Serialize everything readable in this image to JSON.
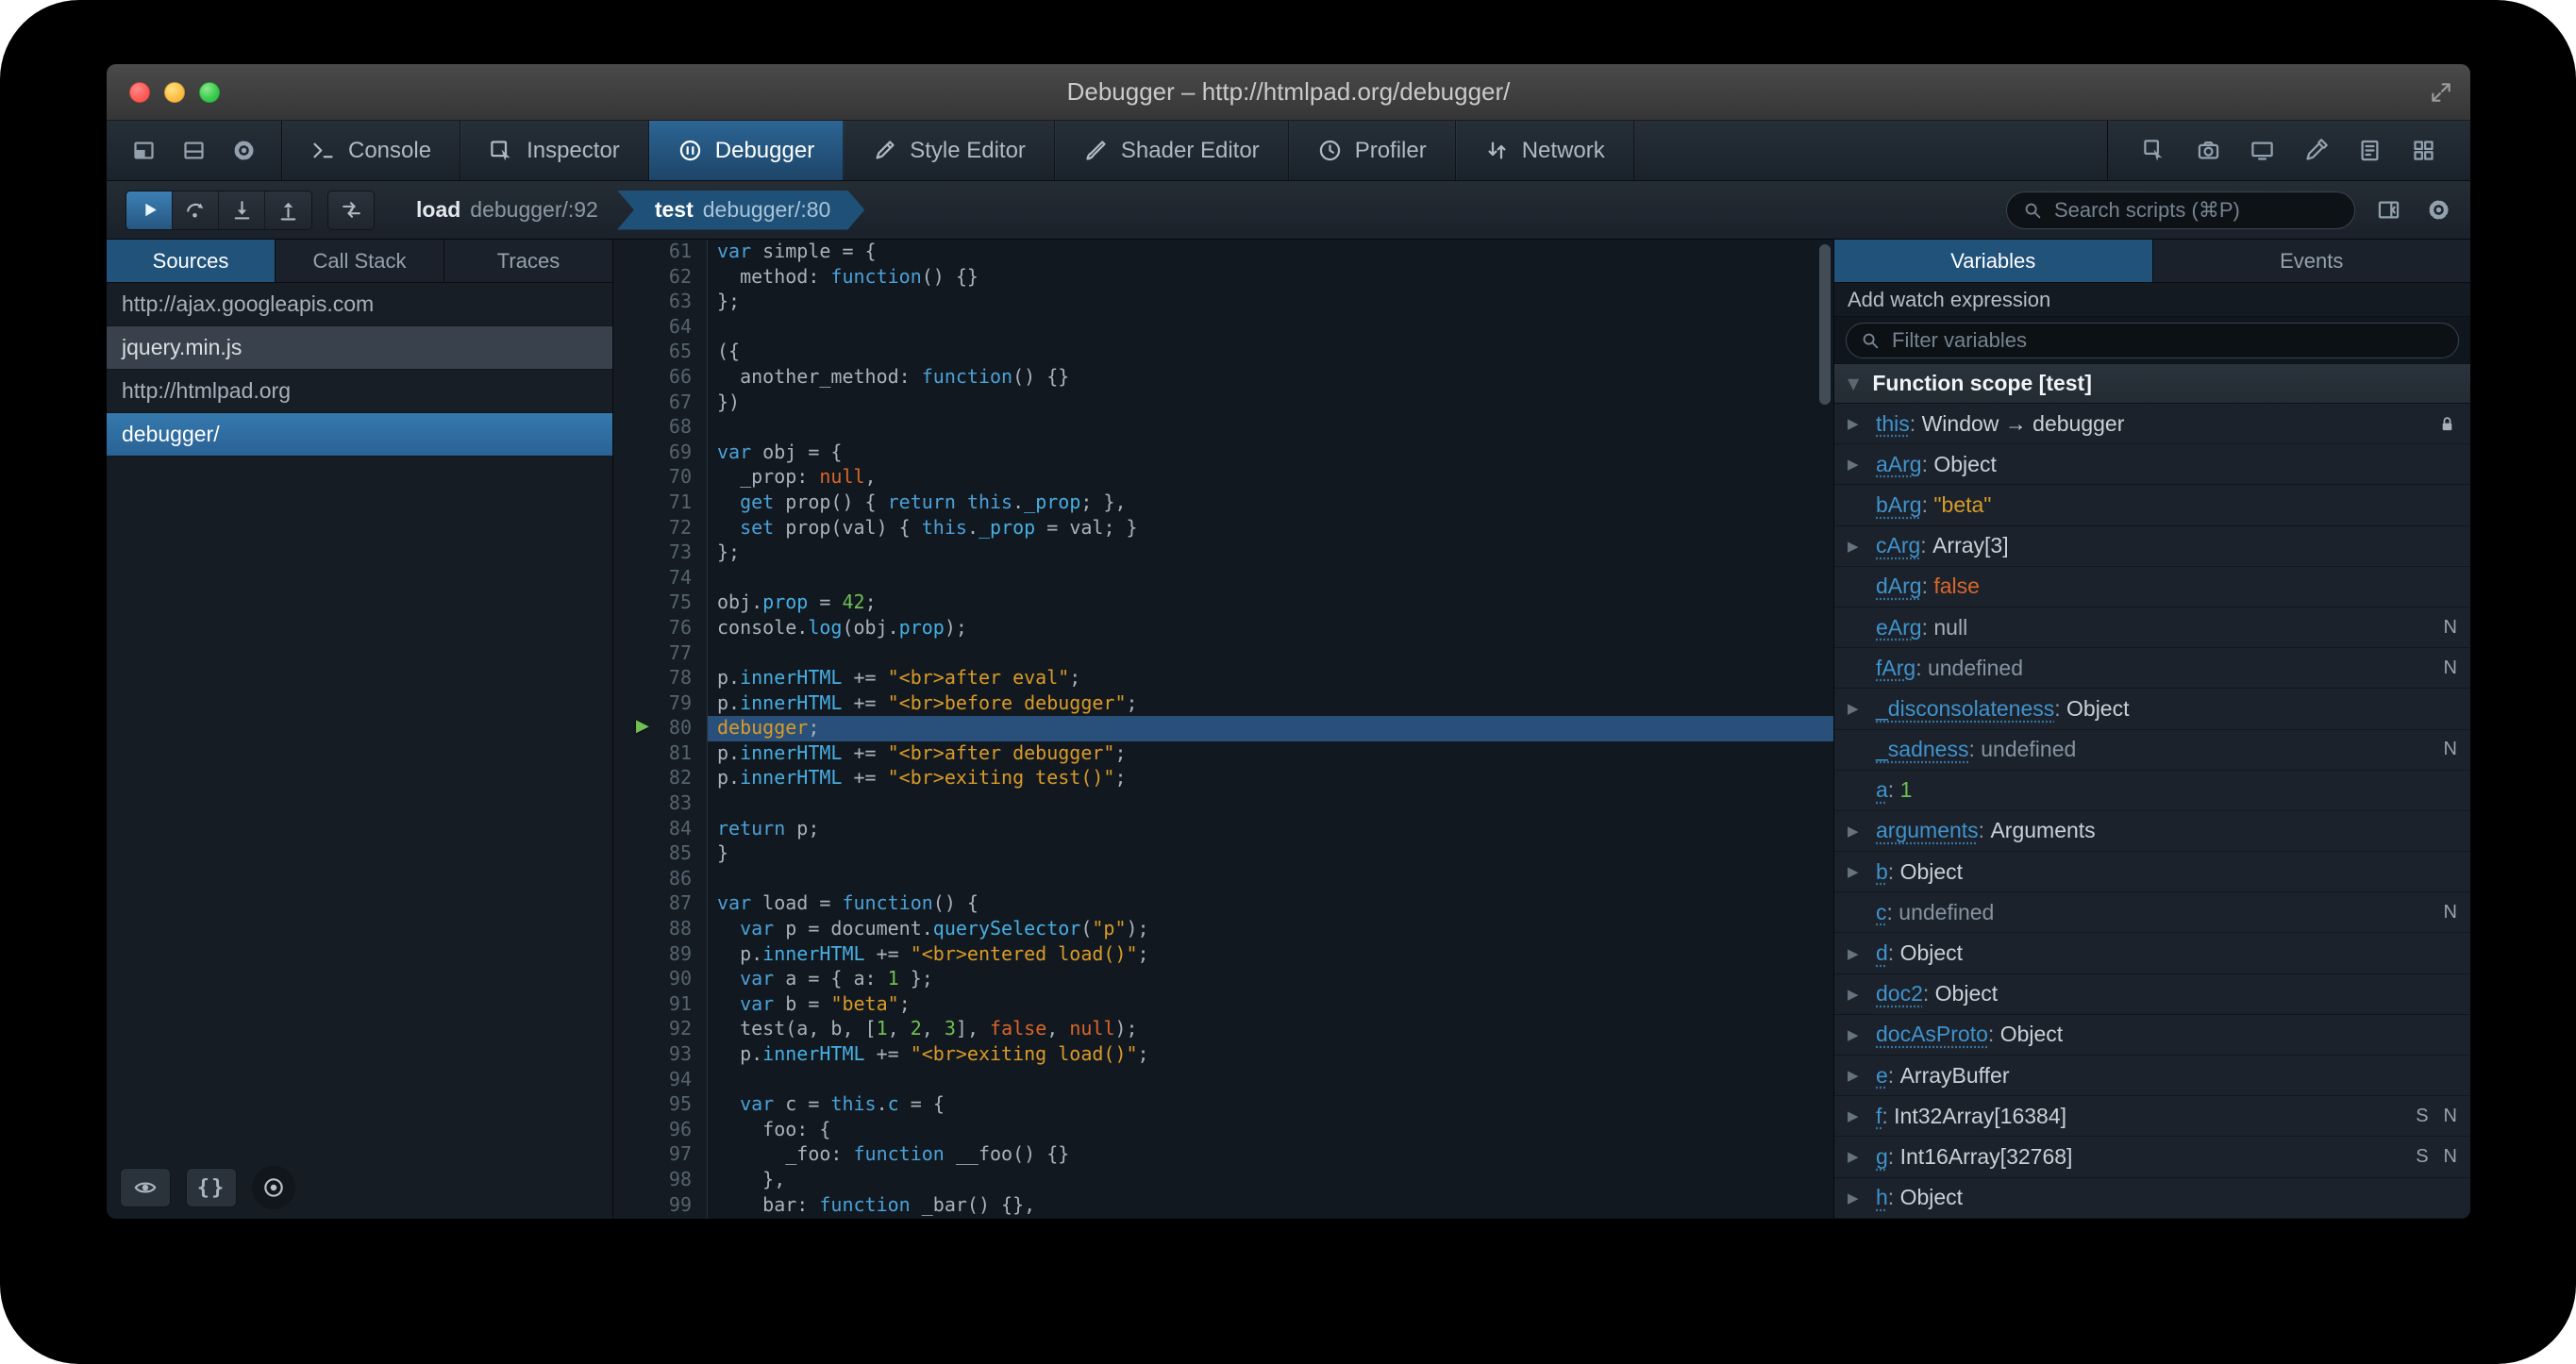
{
  "titlebar": {
    "title": "Debugger – http://htmlpad.org/debugger/",
    "fullscreen_icon": "fullscreen-icon"
  },
  "colors": {
    "accent_blue": "#1d4f73",
    "selection_blue": "#29507a",
    "string_orange": "#d99b28",
    "number_green": "#6fbf53",
    "atom_orange": "#d96629",
    "keyword_blue": "#4aa1d8",
    "property_cyan": "#46afe3",
    "paused_arrow_green": "#72c054"
  },
  "toolbox": {
    "left_icons": [
      "undock-icon",
      "split-console-icon",
      "options-gear-icon"
    ],
    "tabs": [
      {
        "label": "Console",
        "icon": "console-icon"
      },
      {
        "label": "Inspector",
        "icon": "inspector-icon"
      },
      {
        "label": "Debugger",
        "icon": "debugger-icon"
      },
      {
        "label": "Style Editor",
        "icon": "style-editor-icon"
      },
      {
        "label": "Shader Editor",
        "icon": "shader-editor-icon"
      },
      {
        "label": "Profiler",
        "icon": "profiler-icon"
      },
      {
        "label": "Network",
        "icon": "network-icon"
      }
    ],
    "active_tab": "Debugger",
    "right_icons": [
      "pick-element-icon",
      "camera-icon",
      "responsive-mode-icon",
      "eyedropper-icon",
      "scratchpad-icon",
      "grid-icon"
    ]
  },
  "debug_toolbar": {
    "buttons": [
      {
        "name": "resume-button",
        "icon": "resume-icon",
        "pressed": true
      },
      {
        "name": "step-over-button",
        "icon": "step-over-icon"
      },
      {
        "name": "step-in-button",
        "icon": "step-in-icon"
      },
      {
        "name": "step-out-button",
        "icon": "step-out-icon"
      }
    ],
    "trace_icon": "trace-icon",
    "breadcrumbs": [
      {
        "func": "load",
        "location": "debugger/:92",
        "active": false
      },
      {
        "func": "test",
        "location": "debugger/:80",
        "active": true
      }
    ],
    "search_placeholder": "Search scripts (⌘P)",
    "search_icon": "search-icon",
    "right_icons": [
      "toggle-panes-icon",
      "debugger-options-gear-icon"
    ]
  },
  "sources_panel": {
    "tabs": [
      "Sources",
      "Call Stack",
      "Traces"
    ],
    "active_tab": "Sources",
    "items": [
      {
        "label": "http://ajax.googleapis.com",
        "kind": "group",
        "selected": false
      },
      {
        "label": "jquery.min.js",
        "kind": "item",
        "selected": false
      },
      {
        "label": "http://htmlpad.org",
        "kind": "group",
        "selected": false
      },
      {
        "label": "debugger/",
        "kind": "item",
        "selected": true
      }
    ],
    "buttons": [
      {
        "name": "blackbox-button",
        "icon": "eye-icon"
      },
      {
        "name": "pretty-print-button",
        "icon": "braces-icon"
      },
      {
        "name": "pause-exceptions-button",
        "icon": "pause-circle-icon",
        "round": true
      }
    ]
  },
  "editor": {
    "current_line": 80,
    "lines": [
      {
        "n": 61,
        "s": [
          [
            "k",
            "var"
          ],
          [
            "d",
            " simple = {"
          ]
        ]
      },
      {
        "n": 62,
        "s": [
          [
            "d",
            "  method: "
          ],
          [
            "k",
            "function"
          ],
          [
            "d",
            "() {}"
          ]
        ]
      },
      {
        "n": 63,
        "s": [
          [
            "d",
            "};"
          ]
        ]
      },
      {
        "n": 64,
        "s": []
      },
      {
        "n": 65,
        "s": [
          [
            "d",
            "({"
          ]
        ]
      },
      {
        "n": 66,
        "s": [
          [
            "d",
            "  another_method: "
          ],
          [
            "k",
            "function"
          ],
          [
            "d",
            "() {}"
          ]
        ]
      },
      {
        "n": 67,
        "s": [
          [
            "d",
            "})"
          ]
        ]
      },
      {
        "n": 68,
        "s": []
      },
      {
        "n": 69,
        "s": [
          [
            "k",
            "var"
          ],
          [
            "d",
            " obj = {"
          ]
        ]
      },
      {
        "n": 70,
        "s": [
          [
            "d",
            "  _prop: "
          ],
          [
            "a",
            "null"
          ],
          [
            "d",
            ","
          ]
        ]
      },
      {
        "n": 71,
        "s": [
          [
            "d",
            "  "
          ],
          [
            "k",
            "get"
          ],
          [
            "d",
            " prop() { "
          ],
          [
            "k",
            "return"
          ],
          [
            "d",
            " "
          ],
          [
            "k",
            "this"
          ],
          [
            "d",
            "."
          ],
          [
            "p",
            "_prop"
          ],
          [
            "d",
            "; },"
          ]
        ]
      },
      {
        "n": 72,
        "s": [
          [
            "d",
            "  "
          ],
          [
            "k",
            "set"
          ],
          [
            "d",
            " prop(val) { "
          ],
          [
            "k",
            "this"
          ],
          [
            "d",
            "."
          ],
          [
            "p",
            "_prop"
          ],
          [
            "d",
            " = val; }"
          ]
        ]
      },
      {
        "n": 73,
        "s": [
          [
            "d",
            "};"
          ]
        ]
      },
      {
        "n": 74,
        "s": []
      },
      {
        "n": 75,
        "s": [
          [
            "d",
            "obj."
          ],
          [
            "p",
            "prop"
          ],
          [
            "d",
            " = "
          ],
          [
            "n",
            "42"
          ],
          [
            "d",
            ";"
          ]
        ]
      },
      {
        "n": 76,
        "s": [
          [
            "d",
            "console."
          ],
          [
            "p",
            "log"
          ],
          [
            "d",
            "(obj."
          ],
          [
            "p",
            "prop"
          ],
          [
            "d",
            ");"
          ]
        ]
      },
      {
        "n": 77,
        "s": []
      },
      {
        "n": 78,
        "s": [
          [
            "d",
            "p."
          ],
          [
            "p",
            "innerHTML"
          ],
          [
            "d",
            " += "
          ],
          [
            "s",
            "\"<br>after eval\""
          ],
          [
            "d",
            ";"
          ]
        ]
      },
      {
        "n": 79,
        "s": [
          [
            "d",
            "p."
          ],
          [
            "p",
            "innerHTML"
          ],
          [
            "d",
            " += "
          ],
          [
            "s",
            "\"<br>before debugger\""
          ],
          [
            "d",
            ";"
          ]
        ]
      },
      {
        "n": 80,
        "s": [
          [
            "s",
            "debugger"
          ],
          [
            "d",
            ";"
          ]
        ]
      },
      {
        "n": 81,
        "s": [
          [
            "d",
            "p."
          ],
          [
            "p",
            "innerHTML"
          ],
          [
            "d",
            " += "
          ],
          [
            "s",
            "\"<br>after debugger\""
          ],
          [
            "d",
            ";"
          ]
        ]
      },
      {
        "n": 82,
        "s": [
          [
            "d",
            "p."
          ],
          [
            "p",
            "innerHTML"
          ],
          [
            "d",
            " += "
          ],
          [
            "s",
            "\"<br>exiting test()\""
          ],
          [
            "d",
            ";"
          ]
        ]
      },
      {
        "n": 83,
        "s": []
      },
      {
        "n": 84,
        "s": [
          [
            "k",
            "return"
          ],
          [
            "d",
            " p;"
          ]
        ]
      },
      {
        "n": 85,
        "s": [
          [
            "d",
            "}"
          ]
        ]
      },
      {
        "n": 86,
        "s": []
      },
      {
        "n": 87,
        "s": [
          [
            "k",
            "var"
          ],
          [
            "d",
            " load = "
          ],
          [
            "k",
            "function"
          ],
          [
            "d",
            "() {"
          ]
        ]
      },
      {
        "n": 88,
        "s": [
          [
            "d",
            "  "
          ],
          [
            "k",
            "var"
          ],
          [
            "d",
            " p = document."
          ],
          [
            "p",
            "querySelector"
          ],
          [
            "d",
            "("
          ],
          [
            "s",
            "\"p\""
          ],
          [
            "d",
            ");"
          ]
        ]
      },
      {
        "n": 89,
        "s": [
          [
            "d",
            "  p."
          ],
          [
            "p",
            "innerHTML"
          ],
          [
            "d",
            " += "
          ],
          [
            "s",
            "\"<br>entered load()\""
          ],
          [
            "d",
            ";"
          ]
        ]
      },
      {
        "n": 90,
        "s": [
          [
            "d",
            "  "
          ],
          [
            "k",
            "var"
          ],
          [
            "d",
            " a = { a: "
          ],
          [
            "n",
            "1"
          ],
          [
            "d",
            " };"
          ]
        ]
      },
      {
        "n": 91,
        "s": [
          [
            "d",
            "  "
          ],
          [
            "k",
            "var"
          ],
          [
            "d",
            " b = "
          ],
          [
            "s",
            "\"beta\""
          ],
          [
            "d",
            ";"
          ]
        ]
      },
      {
        "n": 92,
        "s": [
          [
            "d",
            "  test(a, b, ["
          ],
          [
            "n",
            "1"
          ],
          [
            "d",
            ", "
          ],
          [
            "n",
            "2"
          ],
          [
            "d",
            ", "
          ],
          [
            "n",
            "3"
          ],
          [
            "d",
            "], "
          ],
          [
            "a",
            "false"
          ],
          [
            "d",
            ", "
          ],
          [
            "a",
            "null"
          ],
          [
            "d",
            ");"
          ]
        ]
      },
      {
        "n": 93,
        "s": [
          [
            "d",
            "  p."
          ],
          [
            "p",
            "innerHTML"
          ],
          [
            "d",
            " += "
          ],
          [
            "s",
            "\"<br>exiting load()\""
          ],
          [
            "d",
            ";"
          ]
        ]
      },
      {
        "n": 94,
        "s": []
      },
      {
        "n": 95,
        "s": [
          [
            "d",
            "  "
          ],
          [
            "k",
            "var"
          ],
          [
            "d",
            " c = "
          ],
          [
            "k",
            "this"
          ],
          [
            "d",
            "."
          ],
          [
            "p",
            "c"
          ],
          [
            "d",
            " = {"
          ]
        ]
      },
      {
        "n": 96,
        "s": [
          [
            "d",
            "    foo: {"
          ]
        ]
      },
      {
        "n": 97,
        "s": [
          [
            "d",
            "      _foo: "
          ],
          [
            "k",
            "function"
          ],
          [
            "d",
            " __foo() {}"
          ]
        ]
      },
      {
        "n": 98,
        "s": [
          [
            "d",
            "    },"
          ]
        ]
      },
      {
        "n": 99,
        "s": [
          [
            "d",
            "    bar: "
          ],
          [
            "k",
            "function"
          ],
          [
            "d",
            " _bar() {},"
          ]
        ]
      }
    ]
  },
  "variables_panel": {
    "tabs": [
      "Variables",
      "Events"
    ],
    "active_tab": "Variables",
    "watch_label": "Add watch expression",
    "filter_placeholder": "Filter variables",
    "filter_icon": "search-icon",
    "scope_label": "Function scope [test]",
    "items": [
      {
        "name": "this",
        "value": "Window → debugger",
        "vclass": "obj",
        "expandable": true,
        "lock": true
      },
      {
        "name": "aArg",
        "value": "Object",
        "vclass": "obj",
        "expandable": true
      },
      {
        "name": "bArg",
        "value": "\"beta\"",
        "vclass": "str",
        "expandable": false
      },
      {
        "name": "cArg",
        "value": "Array[3]",
        "vclass": "obj",
        "expandable": true
      },
      {
        "name": "dArg",
        "value": "false",
        "vclass": "bool",
        "expandable": false
      },
      {
        "name": "eArg",
        "value": "null",
        "vclass": "null",
        "expandable": false,
        "flags": [
          "N"
        ]
      },
      {
        "name": "fArg",
        "value": "undefined",
        "vclass": "undef",
        "expandable": false,
        "flags": [
          "N"
        ]
      },
      {
        "name": "_disconsolateness",
        "value": "Object",
        "vclass": "obj",
        "expandable": true
      },
      {
        "name": "_sadness",
        "value": "undefined",
        "vclass": "undef",
        "expandable": false,
        "flags": [
          "N"
        ]
      },
      {
        "name": "a",
        "value": "1",
        "vclass": "num",
        "expandable": false
      },
      {
        "name": "arguments",
        "value": "Arguments",
        "vclass": "obj",
        "expandable": true
      },
      {
        "name": "b",
        "value": "Object",
        "vclass": "obj",
        "expandable": true
      },
      {
        "name": "c",
        "value": "undefined",
        "vclass": "undef",
        "expandable": false,
        "flags": [
          "N"
        ]
      },
      {
        "name": "d",
        "value": "Object",
        "vclass": "obj",
        "expandable": true
      },
      {
        "name": "doc2",
        "value": "Object",
        "vclass": "obj",
        "expandable": true
      },
      {
        "name": "docAsProto",
        "value": "Object",
        "vclass": "obj",
        "expandable": true
      },
      {
        "name": "e",
        "value": "ArrayBuffer",
        "vclass": "obj",
        "expandable": true
      },
      {
        "name": "f",
        "value": "Int32Array[16384]",
        "vclass": "obj",
        "expandable": true,
        "flags": [
          "S",
          "N"
        ]
      },
      {
        "name": "g",
        "value": "Int16Array[32768]",
        "vclass": "obj",
        "expandable": true,
        "flags": [
          "S",
          "N"
        ]
      },
      {
        "name": "h",
        "value": "Object",
        "vclass": "obj",
        "expandable": true
      }
    ]
  }
}
